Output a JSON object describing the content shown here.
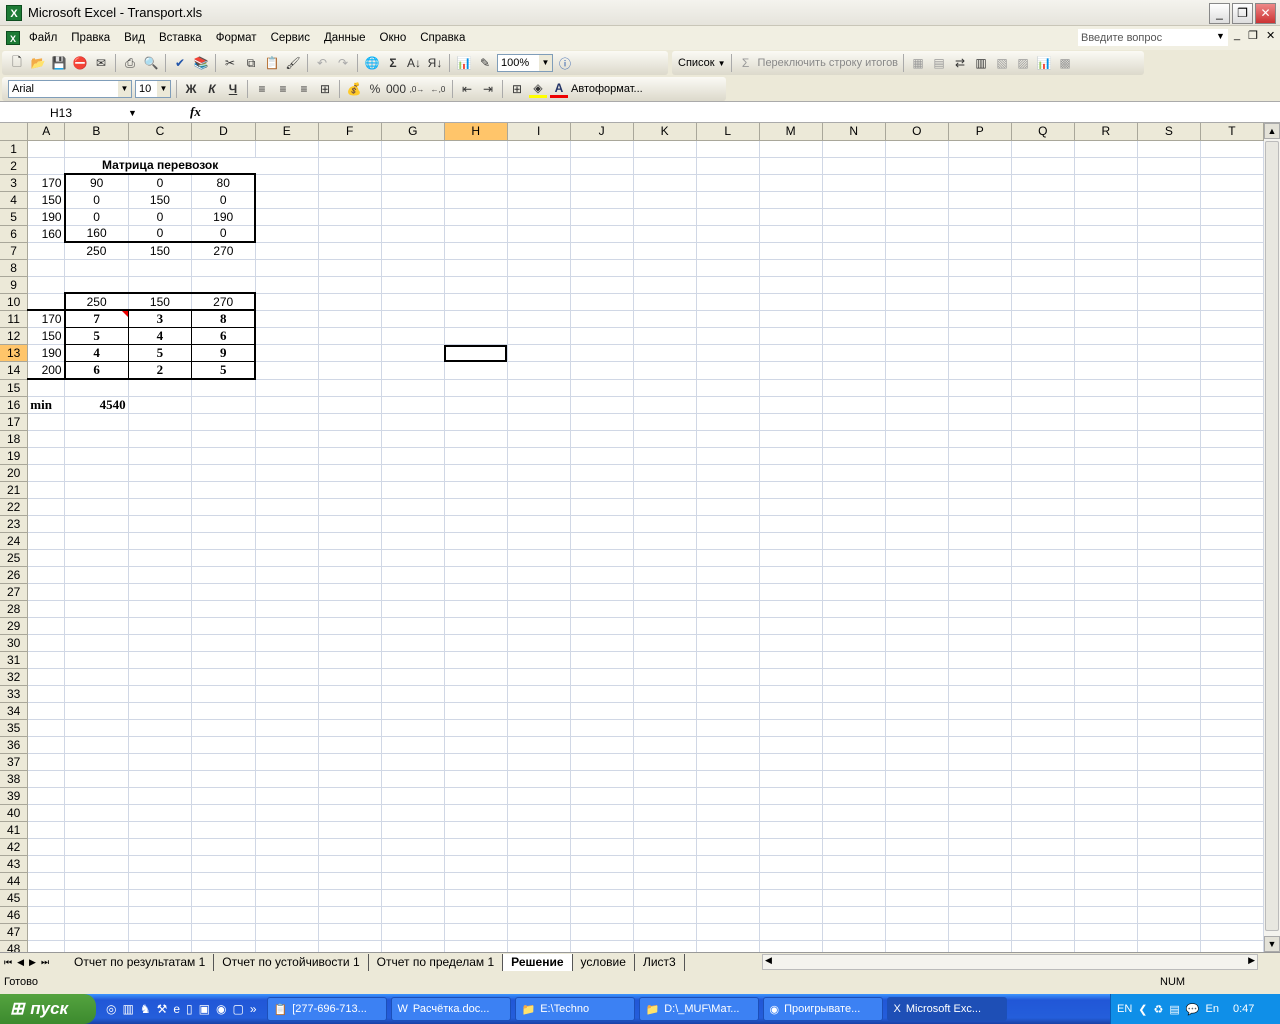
{
  "window": {
    "title": "Microsoft Excel - Transport.xls"
  },
  "menu": {
    "items": [
      "Файл",
      "Правка",
      "Вид",
      "Вставка",
      "Формат",
      "Сервис",
      "Данные",
      "Окно",
      "Справка"
    ],
    "ask_placeholder": "Введите вопрос"
  },
  "toolbar": {
    "zoom": "100%",
    "list_label": "Список",
    "toggle_totals": "Переключить строку итогов",
    "font": "Arial",
    "size": "10",
    "bold": "Ж",
    "italic": "К",
    "underline": "Ч",
    "percent": "%",
    "thousands": "000",
    "autoformat": "Автоформат..."
  },
  "formula_bar": {
    "name_box": "H13",
    "fx": "fx",
    "content": ""
  },
  "columns": [
    "A",
    "B",
    "C",
    "D",
    "E",
    "F",
    "G",
    "H",
    "I",
    "J",
    "K",
    "L",
    "M",
    "N",
    "O",
    "P",
    "Q",
    "R",
    "S",
    "T"
  ],
  "selected": {
    "cell": "H13",
    "row": 13,
    "col": "H"
  },
  "row_count": 48,
  "cells": {
    "B2": "Матрица перевозок",
    "A3": "170",
    "B3": "90",
    "C3": "0",
    "D3": "80",
    "A4": "150",
    "B4": "0",
    "C4": "150",
    "D4": "0",
    "A5": "190",
    "B5": "0",
    "C5": "0",
    "D5": "190",
    "A6": "160",
    "B6": "160",
    "C6": "0",
    "D6": "0",
    "B7": "250",
    "C7": "150",
    "D7": "270",
    "B10": "250",
    "C10": "150",
    "D10": "270",
    "A11": "170",
    "B11": "7",
    "C11": "3",
    "D11": "8",
    "A12": "150",
    "B12": "5",
    "C12": "4",
    "D12": "6",
    "A13": "190",
    "B13": "4",
    "C13": "5",
    "D13": "9",
    "A14": "200",
    "B14": "6",
    "C14": "2",
    "D14": "5",
    "A16": "min",
    "B16": "4540"
  },
  "sheets": [
    {
      "name": "Отчет по результатам 1"
    },
    {
      "name": "Отчет по устойчивости 1"
    },
    {
      "name": "Отчет по пределам 1"
    },
    {
      "name": "Решение",
      "active": true
    },
    {
      "name": "условие"
    },
    {
      "name": "Лист3"
    }
  ],
  "status": {
    "ready": "Готово",
    "num": "NUM"
  },
  "taskbar": {
    "start": "пуск",
    "tasks": [
      "[277-696-713...",
      "Расчётка.doc...",
      "E:\\Techno",
      "D:\\_MUF\\Мат...",
      "Проигрывате...",
      "Microsoft Exc..."
    ],
    "lang": "EN",
    "lang2": "En",
    "clock": "0:47"
  }
}
